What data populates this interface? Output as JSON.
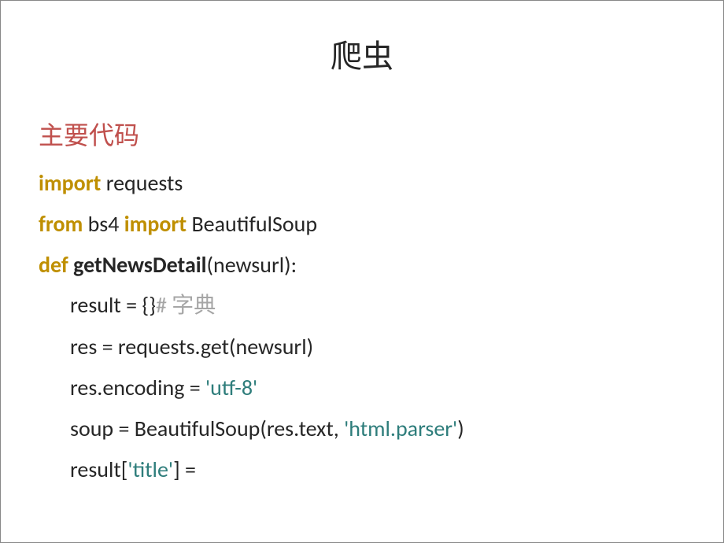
{
  "slide": {
    "title": "爬虫",
    "subtitle": "主要代码"
  },
  "code": {
    "line1": {
      "kw1": "import",
      "rest": " requests"
    },
    "line2": {
      "kw1": "from",
      "mid": " bs4 ",
      "kw2": "import",
      "rest": " BeautifulSoup"
    },
    "line3": {
      "kw1": "def ",
      "fn": "getNewsDetail",
      "rest": "(newsurl):"
    },
    "line4": {
      "text": "result = {}",
      "comment_hash": "# ",
      "comment_text": "字典"
    },
    "line5": {
      "text": "res = requests.get(newsurl)"
    },
    "line6": {
      "pre": "res.encoding = ",
      "str": "'utf-8'"
    },
    "line7": {
      "pre": "soup = BeautifulSoup(res.text, ",
      "str": "'html.parser'",
      "post": ")"
    },
    "line8": {
      "pre": "result[",
      "str": "'title'",
      "post": "] ="
    }
  }
}
